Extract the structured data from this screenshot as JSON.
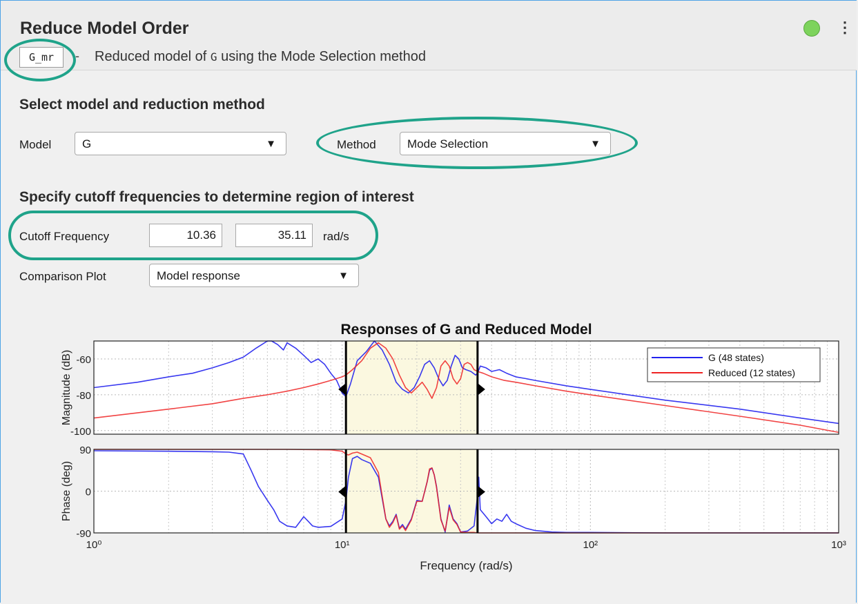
{
  "header": {
    "title": "Reduce Model Order",
    "output_variable": "G_mr",
    "dash": "-",
    "description_prefix": "Reduced model of ",
    "description_model": "G",
    "description_suffix": " using the Mode Selection method",
    "status_color": "#7dd35c",
    "menu_icon": "⋮"
  },
  "section1": {
    "heading": "Select model and reduction method",
    "model_label": "Model",
    "model_value": "G",
    "method_label": "Method",
    "method_value": "Mode Selection"
  },
  "section2": {
    "heading": "Specify cutoff frequencies to determine region of interest",
    "cutoff_label": "Cutoff Frequency",
    "cutoff_low": "10.36",
    "cutoff_high": "35.11",
    "cutoff_unit": "rad/s",
    "plot_label": "Comparison Plot",
    "plot_value": "Model response"
  },
  "dropdown_arrow": "▼",
  "highlight_color": "#1fa38a",
  "chart_data": {
    "type": "line",
    "title": "Responses of G and Reduced Model",
    "xlabel": "Frequency  (rad/s)",
    "x_scale": "log",
    "xlim": [
      1,
      1000
    ],
    "x_ticks": [
      "10⁰",
      "10¹",
      "10²",
      "10³"
    ],
    "region_of_interest": [
      10.36,
      35.11
    ],
    "legend_position": "top-right",
    "subplots": [
      {
        "ylabel": "Magnitude (dB)",
        "ylim": [
          -102,
          -50
        ],
        "y_ticks": [
          "-60",
          "-80",
          "-100"
        ],
        "y_tick_values": [
          -60,
          -80,
          -100
        ],
        "series": [
          {
            "name": "G (48 states)",
            "color": "#2222ee",
            "x": [
              1,
              1.5,
              2,
              2.5,
              3,
              3.5,
              4,
              4.5,
              5,
              5.2,
              5.5,
              5.8,
              6,
              6.5,
              7,
              7.5,
              8,
              8.5,
              9,
              9.5,
              10,
              10.36,
              10.8,
              11.5,
              12.5,
              13.5,
              14.5,
              15.5,
              16.5,
              17.5,
              18.5,
              19.5,
              20.5,
              21.5,
              22.5,
              23.5,
              24.5,
              25.5,
              26.5,
              27.5,
              28.5,
              29.5,
              30.5,
              31.5,
              33,
              34.5,
              35.11,
              36,
              38,
              40,
              43,
              46,
              50,
              55,
              60,
              80,
              100,
              200,
              400,
              700,
              1000
            ],
            "y": [
              -76,
              -73,
              -70,
              -68,
              -65,
              -62,
              -59,
              -54,
              -48,
              -47,
              -52,
              -55,
              -51,
              -54,
              -58,
              -62,
              -60,
              -63,
              -68,
              -72,
              -79,
              -81,
              -74,
              -61,
              -56,
              -50,
              -55,
              -63,
              -73,
              -77,
              -79,
              -76,
              -70,
              -63,
              -61,
              -65,
              -71,
              -75,
              -72,
              -64,
              -58,
              -60,
              -65,
              -66,
              -67,
              -69,
              -68,
              -64,
              -65,
              -67,
              -66,
              -68,
              -70,
              -71,
              -72,
              -75,
              -77,
              -83,
              -88,
              -93,
              -96
            ]
          },
          {
            "name": "Reduced (12 states)",
            "color": "#ee2222",
            "x": [
              1,
              2,
              3,
              4,
              5,
              6,
              7,
              8,
              9,
              10,
              10.36,
              11,
              12,
              13,
              14,
              15,
              16,
              17,
              18,
              19,
              20,
              21,
              22,
              23,
              24,
              25,
              26,
              27,
              28,
              29,
              30,
              31,
              32,
              33,
              34,
              35.11,
              37,
              40,
              45,
              50,
              60,
              80,
              100,
              200,
              400,
              700,
              1000
            ],
            "y": [
              -93,
              -88,
              -85,
              -82,
              -80,
              -78,
              -76,
              -74,
              -72,
              -70,
              -69,
              -66,
              -61,
              -54,
              -51,
              -54,
              -60,
              -69,
              -76,
              -79,
              -76,
              -73,
              -77,
              -82,
              -76,
              -64,
              -61,
              -64,
              -71,
              -74,
              -71,
              -63,
              -62,
              -63,
              -66,
              -67,
              -68,
              -70,
              -72,
              -73,
              -75,
              -78,
              -80,
              -86,
              -92,
              -97,
              -101
            ]
          }
        ]
      },
      {
        "ylabel": "Phase (deg)",
        "ylim": [
          -90,
          90
        ],
        "y_ticks": [
          "90",
          "0",
          "-90"
        ],
        "y_tick_values": [
          90,
          0,
          -90
        ],
        "series": [
          {
            "name": "G (48 states)",
            "color": "#2222ee",
            "x": [
              1,
              2,
              3,
              3.5,
              4,
              4.3,
              4.6,
              5,
              5.3,
              5.6,
              6,
              6.5,
              7,
              7.3,
              7.6,
              8,
              9,
              10,
              10.36,
              10.6,
              11,
              11.5,
              12,
              13,
              14,
              15,
              15.5,
              16,
              16.5,
              17,
              17.5,
              18,
              19,
              20,
              21,
              22,
              22.5,
              23,
              23.5,
              24,
              25,
              26,
              27,
              28,
              29,
              30,
              32,
              34,
              35.11,
              35.5,
              36,
              38,
              40,
              42,
              44,
              46,
              48,
              50,
              55,
              60,
              70,
              80,
              100,
              200,
              400,
              1000
            ],
            "y": [
              87,
              86,
              85,
              84,
              80,
              45,
              10,
              -20,
              -40,
              -65,
              -75,
              -78,
              -55,
              -65,
              -75,
              -78,
              -76,
              -60,
              -20,
              30,
              70,
              75,
              68,
              60,
              30,
              -60,
              -75,
              -65,
              -50,
              -80,
              -72,
              -82,
              -60,
              -20,
              -22,
              20,
              45,
              50,
              35,
              10,
              -60,
              -88,
              -30,
              -60,
              -70,
              -88,
              -86,
              -75,
              -10,
              30,
              -40,
              -55,
              -70,
              -60,
              -65,
              -50,
              -65,
              -70,
              -80,
              -85,
              -88,
              -89,
              -89,
              -90,
              -90,
              -90
            ]
          },
          {
            "name": "Reduced (12 states)",
            "color": "#ee2222",
            "x": [
              1,
              3,
              6,
              9,
              10,
              10.36,
              10.6,
              11,
              11.5,
              12,
              13,
              14,
              15,
              15.5,
              16,
              16.5,
              17,
              17.5,
              18,
              19,
              20,
              21,
              22,
              22.5,
              23,
              23.5,
              24,
              25,
              26,
              27,
              28,
              29,
              30,
              32,
              34,
              35.11,
              36,
              40,
              60,
              100,
              1000
            ],
            "y": [
              90,
              90,
              90,
              89,
              86,
              80,
              78,
              82,
              84,
              80,
              72,
              40,
              -60,
              -78,
              -68,
              -52,
              -82,
              -75,
              -85,
              -62,
              -22,
              -22,
              20,
              48,
              50,
              35,
              8,
              -62,
              -86,
              -35,
              -62,
              -72,
              -88,
              -89,
              -89,
              -90,
              -90,
              -90,
              -90,
              -90,
              -90
            ]
          }
        ]
      }
    ]
  }
}
